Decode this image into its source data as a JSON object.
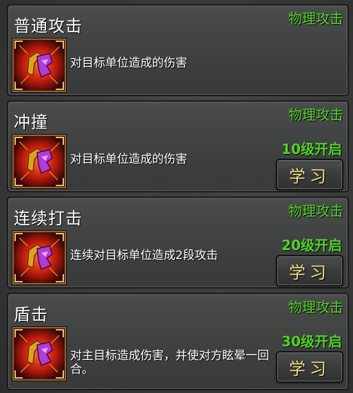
{
  "skills": [
    {
      "name": "普通攻击",
      "type": "物理攻击",
      "description": "对目标单位造成的伤害",
      "unlock": "",
      "button": "",
      "icon": "fist-strike-icon"
    },
    {
      "name": "冲撞",
      "type": "物理攻击",
      "description": "对目标单位造成的伤害",
      "unlock": "10级开启",
      "button": "学习",
      "icon": "fist-strike-icon"
    },
    {
      "name": "连续打击",
      "type": "物理攻击",
      "description": "连续对目标单位造成2段攻击",
      "unlock": "20级开启",
      "button": "学习",
      "icon": "fist-strike-icon"
    },
    {
      "name": "盾击",
      "type": "物理攻击",
      "description": "对主目标造成伤害，并使对方眩晕一回合。",
      "unlock": "30级开启",
      "button": "学习",
      "icon": "fist-strike-icon"
    }
  ],
  "colors": {
    "type_text": "#52d12a",
    "button_text": "#f7dd8c",
    "panel_bg": "#404241"
  }
}
